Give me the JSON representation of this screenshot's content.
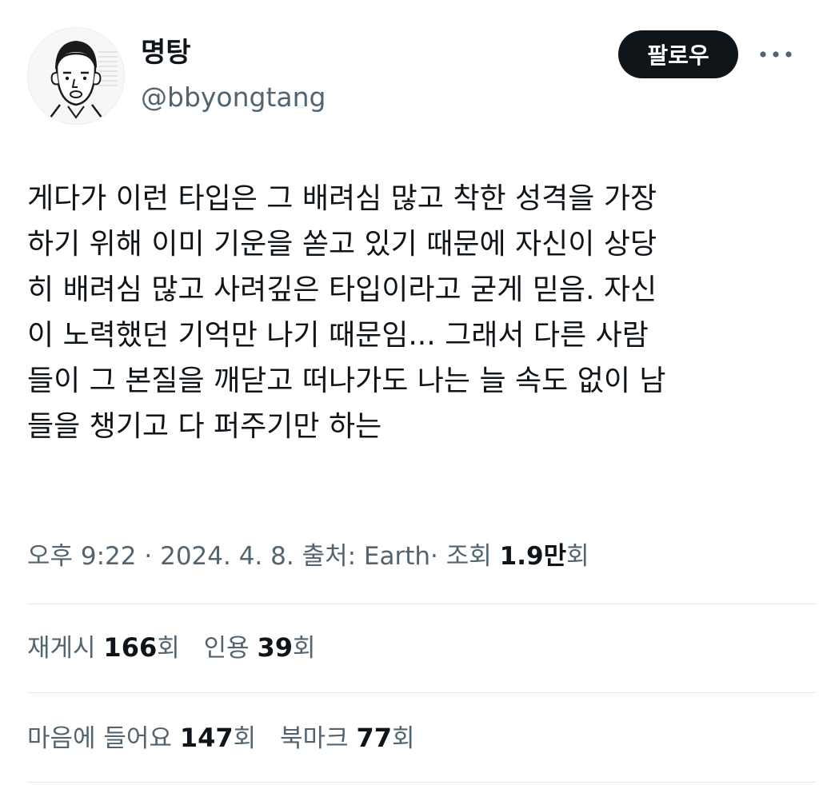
{
  "author": {
    "display_name": "명탕",
    "handle": "@bbyongtang"
  },
  "header": {
    "follow_label": "팔로우",
    "more_icon": "more-icon"
  },
  "tweet": {
    "lines": [
      "게다가 이런 타입은 그 배려심 많고 착한 성격을 가장",
      "하기 위해 이미 기운을 쏟고 있기 때문에 자신이 상당",
      "히 배려심 많고 사려깊은 타입이라고 굳게 믿음. 자신",
      "이 노력했던 기억만 나기 때문임... 그래서 다른 사람",
      "들이 그 본질을 깨닫고 떠나가도 나는 늘 속도 없이 남",
      "들을 챙기고 다 퍼주기만 하는"
    ]
  },
  "meta": {
    "time": "오후 9:22",
    "date": "2024. 4. 8.",
    "source": "출처: Earth",
    "views_label": "조회",
    "views_value": "1.9만",
    "views_suffix": "회",
    "separator": "·"
  },
  "stats": {
    "retweets_label": "재게시",
    "retweets_value": "166",
    "quotes_label": "인용",
    "quotes_value": "39",
    "likes_label": "마음에 들어요",
    "likes_value": "147",
    "bookmarks_label": "북마크",
    "bookmarks_value": "77",
    "count_suffix": "회"
  },
  "colors": {
    "text": "#0f1419",
    "secondary": "#536471",
    "divider": "#e6e9ec",
    "button_bg": "#0f1419"
  }
}
